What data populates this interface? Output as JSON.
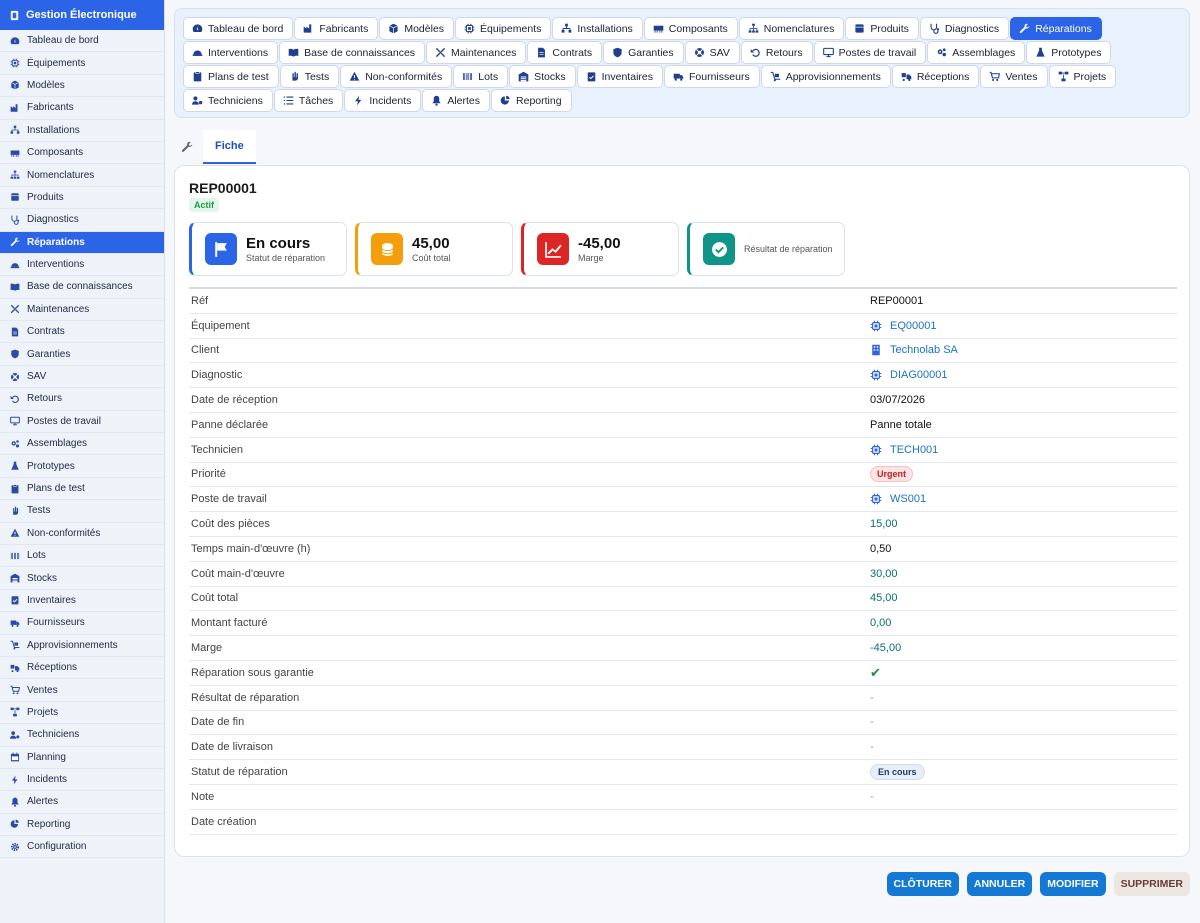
{
  "app": {
    "title": "Gestion Électronique"
  },
  "sidebar": {
    "items": [
      {
        "label": "Tableau de bord",
        "icon": "gauge-icon"
      },
      {
        "label": "Équipements",
        "icon": "chip-icon"
      },
      {
        "label": "Modèles",
        "icon": "cube-icon"
      },
      {
        "label": "Fabricants",
        "icon": "factory-icon"
      },
      {
        "label": "Installations",
        "icon": "network-icon"
      },
      {
        "label": "Composants",
        "icon": "memory-icon"
      },
      {
        "label": "Nomenclatures",
        "icon": "sitemap-icon"
      },
      {
        "label": "Produits",
        "icon": "box-icon"
      },
      {
        "label": "Diagnostics",
        "icon": "stethoscope-icon"
      },
      {
        "label": "Réparations",
        "icon": "wrench-icon",
        "active": true
      },
      {
        "label": "Interventions",
        "icon": "helmet-icon"
      },
      {
        "label": "Base de connaissances",
        "icon": "book-icon"
      },
      {
        "label": "Maintenances",
        "icon": "tools-icon"
      },
      {
        "label": "Contrats",
        "icon": "file-icon"
      },
      {
        "label": "Garanties",
        "icon": "shield-icon"
      },
      {
        "label": "SAV",
        "icon": "lifebuoy-icon"
      },
      {
        "label": "Retours",
        "icon": "undo-icon"
      },
      {
        "label": "Postes de travail",
        "icon": "desktop-icon"
      },
      {
        "label": "Assemblages",
        "icon": "cogs-icon"
      },
      {
        "label": "Prototypes",
        "icon": "flask-icon"
      },
      {
        "label": "Plans de test",
        "icon": "clipboard-icon"
      },
      {
        "label": "Tests",
        "icon": "hand-icon"
      },
      {
        "label": "Non-conformités",
        "icon": "warning-icon"
      },
      {
        "label": "Lots",
        "icon": "barcode-icon"
      },
      {
        "label": "Stocks",
        "icon": "warehouse-icon"
      },
      {
        "label": "Inventaires",
        "icon": "clipboard-check-icon"
      },
      {
        "label": "Fournisseurs",
        "icon": "truck-icon"
      },
      {
        "label": "Approvisionnements",
        "icon": "dolly-icon"
      },
      {
        "label": "Réceptions",
        "icon": "truck-loading-icon"
      },
      {
        "label": "Ventes",
        "icon": "cart-icon"
      },
      {
        "label": "Projets",
        "icon": "diagram-icon"
      },
      {
        "label": "Techniciens",
        "icon": "users-cog-icon"
      },
      {
        "label": "Planning",
        "icon": "calendar-icon"
      },
      {
        "label": "Incidents",
        "icon": "bolt-icon"
      },
      {
        "label": "Alertes",
        "icon": "bell-icon"
      },
      {
        "label": "Reporting",
        "icon": "pie-icon"
      },
      {
        "label": "Configuration",
        "icon": "gear-icon"
      }
    ]
  },
  "topnav": {
    "items": [
      {
        "label": "Tableau de bord",
        "icon": "gauge-icon"
      },
      {
        "label": "Fabricants",
        "icon": "factory-icon"
      },
      {
        "label": "Modèles",
        "icon": "cube-icon"
      },
      {
        "label": "Équipements",
        "icon": "chip-icon"
      },
      {
        "label": "Installations",
        "icon": "network-icon"
      },
      {
        "label": "Composants",
        "icon": "memory-icon"
      },
      {
        "label": "Nomenclatures",
        "icon": "sitemap-icon"
      },
      {
        "label": "Produits",
        "icon": "box-icon"
      },
      {
        "label": "Diagnostics",
        "icon": "stethoscope-icon"
      },
      {
        "label": "Réparations",
        "icon": "wrench-icon",
        "active": true
      },
      {
        "label": "Interventions",
        "icon": "helmet-icon"
      },
      {
        "label": "Base de connaissances",
        "icon": "book-icon"
      },
      {
        "label": "Maintenances",
        "icon": "tools-icon"
      },
      {
        "label": "Contrats",
        "icon": "file-icon"
      },
      {
        "label": "Garanties",
        "icon": "shield-icon"
      },
      {
        "label": "SAV",
        "icon": "lifebuoy-icon"
      },
      {
        "label": "Retours",
        "icon": "undo-icon"
      },
      {
        "label": "Postes de travail",
        "icon": "desktop-icon"
      },
      {
        "label": "Assemblages",
        "icon": "cogs-icon"
      },
      {
        "label": "Prototypes",
        "icon": "flask-icon"
      },
      {
        "label": "Plans de test",
        "icon": "clipboard-icon"
      },
      {
        "label": "Tests",
        "icon": "hand-icon"
      },
      {
        "label": "Non-conformités",
        "icon": "warning-icon"
      },
      {
        "label": "Lots",
        "icon": "barcode-icon"
      },
      {
        "label": "Stocks",
        "icon": "warehouse-icon"
      },
      {
        "label": "Inventaires",
        "icon": "clipboard-check-icon"
      },
      {
        "label": "Fournisseurs",
        "icon": "truck-icon"
      },
      {
        "label": "Approvisionnements",
        "icon": "dolly-icon"
      },
      {
        "label": "Réceptions",
        "icon": "truck-loading-icon"
      },
      {
        "label": "Ventes",
        "icon": "cart-icon"
      },
      {
        "label": "Projets",
        "icon": "diagram-icon"
      },
      {
        "label": "Techniciens",
        "icon": "users-cog-icon"
      },
      {
        "label": "Tâches",
        "icon": "tasks-icon"
      },
      {
        "label": "Incidents",
        "icon": "bolt-icon"
      },
      {
        "label": "Alertes",
        "icon": "bell-icon"
      },
      {
        "label": "Reporting",
        "icon": "pie-icon"
      }
    ]
  },
  "tabs": {
    "fiche": "Fiche"
  },
  "record": {
    "id": "REP00001",
    "status_badge": "Actif",
    "stats": [
      {
        "value": "En cours",
        "label": "Statut de réparation",
        "color": "blue",
        "icon": "flag-icon"
      },
      {
        "value": "45,00",
        "label": "Coût total",
        "color": "orange",
        "icon": "coins-icon"
      },
      {
        "value": "-45,00",
        "label": "Marge",
        "color": "red",
        "icon": "chart-line-icon"
      },
      {
        "value": "",
        "label": "Résultat de réparation",
        "color": "teal",
        "icon": "check-circle-icon"
      }
    ],
    "fields": [
      {
        "label": "Réf",
        "value": "REP00001",
        "type": "text"
      },
      {
        "label": "Équipement",
        "value": "EQ00001",
        "type": "link",
        "icon": "chip-icon"
      },
      {
        "label": "Client",
        "value": "Technolab SA",
        "type": "link",
        "icon": "building-icon"
      },
      {
        "label": "Diagnostic",
        "value": "DIAG00001",
        "type": "link",
        "icon": "chip-icon"
      },
      {
        "label": "Date de réception",
        "value": "03/07/2026",
        "type": "text"
      },
      {
        "label": "Panne déclarée",
        "value": "Panne totale",
        "type": "text"
      },
      {
        "label": "Technicien",
        "value": "TECH001",
        "type": "link",
        "icon": "chip-icon"
      },
      {
        "label": "Priorité",
        "value": "Urgent",
        "type": "urgent"
      },
      {
        "label": "Poste de travail",
        "value": "WS001",
        "type": "link",
        "icon": "chip-icon"
      },
      {
        "label": "Coût des pièces",
        "value": "15,00",
        "type": "money"
      },
      {
        "label": "Temps main-d'œuvre (h)",
        "value": "0,50",
        "type": "text"
      },
      {
        "label": "Coût main-d'œuvre",
        "value": "30,00",
        "type": "money"
      },
      {
        "label": "Coût total",
        "value": "45,00",
        "type": "money"
      },
      {
        "label": "Montant facturé",
        "value": "0,00",
        "type": "money"
      },
      {
        "label": "Marge",
        "value": "-45,00",
        "type": "money"
      },
      {
        "label": "Réparation sous garantie",
        "value": "✔",
        "type": "check"
      },
      {
        "label": "Résultat de réparation",
        "value": "-",
        "type": "dash"
      },
      {
        "label": "Date de fin",
        "value": "-",
        "type": "dash"
      },
      {
        "label": "Date de livraison",
        "value": "-",
        "type": "dash"
      },
      {
        "label": "Statut de réparation",
        "value": "En cours",
        "type": "pill"
      },
      {
        "label": "Note",
        "value": "-",
        "type": "dash"
      },
      {
        "label": "Date création",
        "value": "",
        "type": "text"
      }
    ]
  },
  "actions": {
    "close": "CLÔTURER",
    "cancel": "ANNULER",
    "edit": "MODIFIER",
    "delete": "SUPPRIMER"
  }
}
